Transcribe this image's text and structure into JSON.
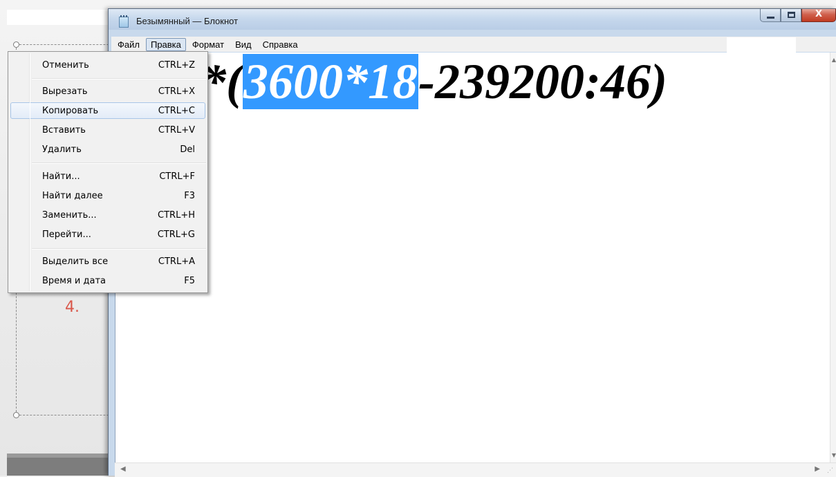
{
  "slide": {
    "number": "4."
  },
  "window": {
    "title": "Безымянный — Блокнот",
    "controls": {
      "minimize": "",
      "maximize": "",
      "close": "X"
    }
  },
  "menubar": {
    "items": [
      "Файл",
      "Правка",
      "Формат",
      "Вид",
      "Справка"
    ],
    "active": "Правка"
  },
  "editor": {
    "text_before": "*(",
    "text_selected": "3600*18",
    "text_after": "-239200:46)"
  },
  "dropdown": {
    "items": [
      {
        "label": "Отменить",
        "shortcut": "CTRL+Z"
      },
      {
        "label": "Вырезать",
        "shortcut": "CTRL+X"
      },
      {
        "label": "Копировать",
        "shortcut": "CTRL+C"
      },
      {
        "label": "Вставить",
        "shortcut": "CTRL+V"
      },
      {
        "label": "Удалить",
        "shortcut": "Del"
      },
      {
        "label": "Найти...",
        "shortcut": "CTRL+F"
      },
      {
        "label": "Найти далее",
        "shortcut": "F3"
      },
      {
        "label": "Заменить...",
        "shortcut": "CTRL+H"
      },
      {
        "label": "Перейти...",
        "shortcut": "CTRL+G"
      },
      {
        "label": "Выделить все",
        "shortcut": "CTRL+A"
      },
      {
        "label": "Время и дата",
        "shortcut": "F5"
      }
    ],
    "highlighted": "Копировать"
  },
  "colors": {
    "selection": "#3399ff",
    "close_button": "#c03a22",
    "slide_number": "#d9574a"
  }
}
